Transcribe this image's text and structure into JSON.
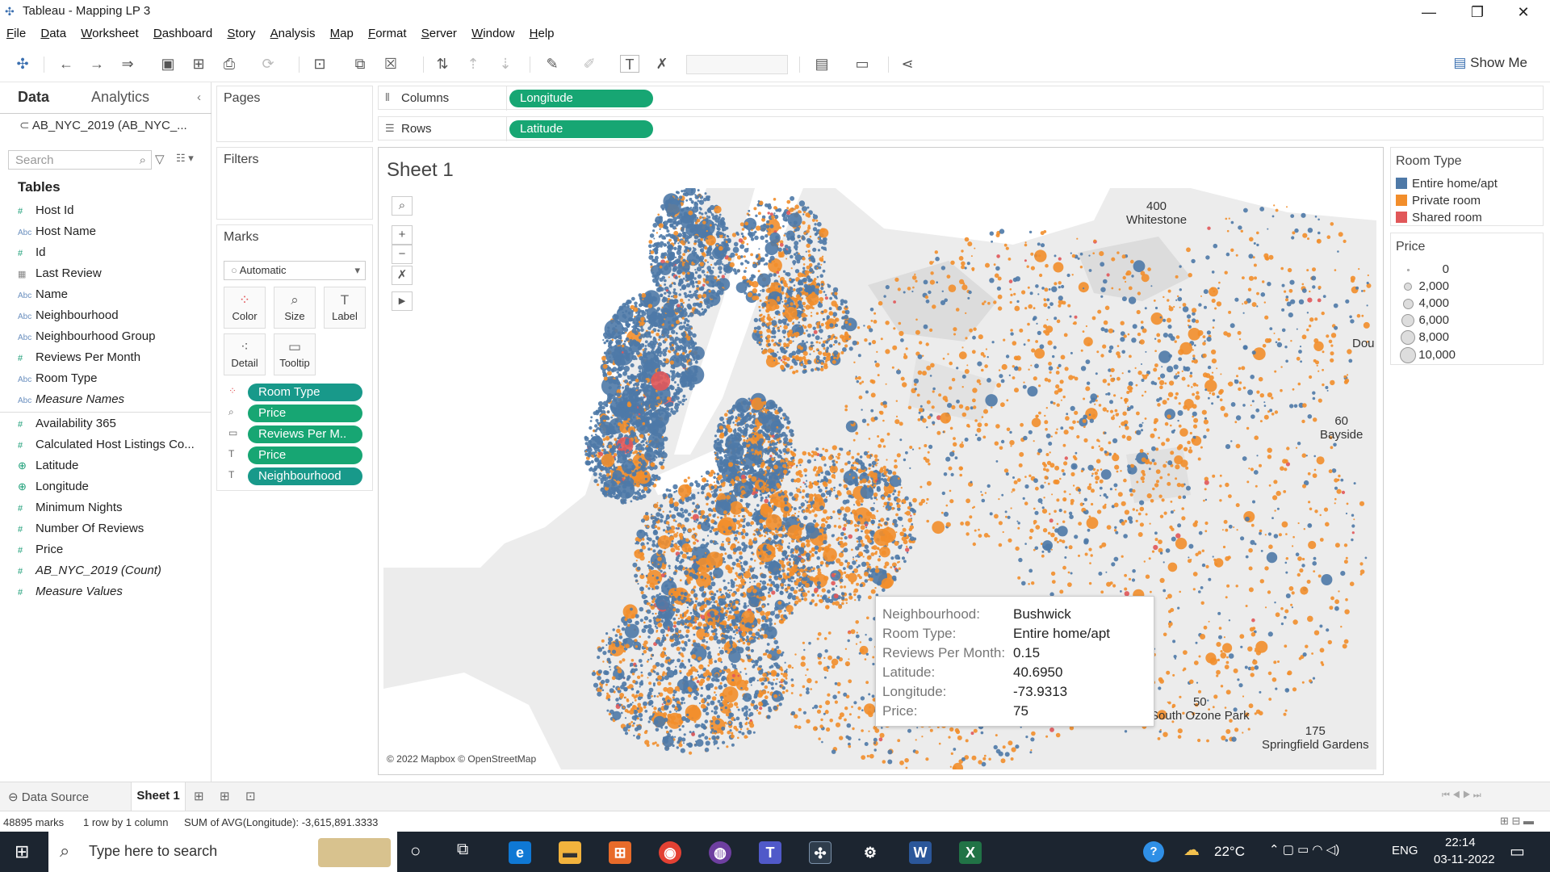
{
  "window": {
    "title": "Tableau - Mapping LP 3",
    "minimize": "—",
    "restore": "❐",
    "close": "✕"
  },
  "menu": [
    "File",
    "Data",
    "Worksheet",
    "Dashboard",
    "Story",
    "Analysis",
    "Map",
    "Format",
    "Server",
    "Window",
    "Help"
  ],
  "toolbar": {
    "show_me": "Show Me"
  },
  "data_pane": {
    "tabs": [
      "Data",
      "Analytics"
    ],
    "datasource": "AB_NYC_2019 (AB_NYC_...",
    "search_placeholder": "Search",
    "tables_heading": "Tables",
    "fields": [
      {
        "icon": "#",
        "name": "Host Id"
      },
      {
        "icon": "Abc",
        "name": "Host Name"
      },
      {
        "icon": "#",
        "name": "Id"
      },
      {
        "icon": "▦",
        "name": "Last Review"
      },
      {
        "icon": "Abc",
        "name": "Name"
      },
      {
        "icon": "Abc",
        "name": "Neighbourhood"
      },
      {
        "icon": "Abc",
        "name": "Neighbourhood Group"
      },
      {
        "icon": "#",
        "name": "Reviews Per Month"
      },
      {
        "icon": "Abc",
        "name": "Room Type"
      },
      {
        "icon": "Abc",
        "name": "Measure Names"
      },
      {
        "icon": "#",
        "name": "Availability 365"
      },
      {
        "icon": "#",
        "name": "Calculated Host Listings Co..."
      },
      {
        "icon": "⊕",
        "name": "Latitude"
      },
      {
        "icon": "⊕",
        "name": "Longitude"
      },
      {
        "icon": "#",
        "name": "Minimum Nights"
      },
      {
        "icon": "#",
        "name": "Number Of Reviews"
      },
      {
        "icon": "#",
        "name": "Price"
      },
      {
        "icon": "#",
        "name": "AB_NYC_2019 (Count)"
      },
      {
        "icon": "#",
        "name": "Measure Values"
      }
    ]
  },
  "shelves": {
    "pages": "Pages",
    "filters": "Filters",
    "columns_label": "Columns",
    "columns_pill": "Longitude",
    "rows_label": "Rows",
    "rows_pill": "Latitude"
  },
  "marks": {
    "title": "Marks",
    "mark_type": "Automatic",
    "buttons": [
      "Color",
      "Size",
      "Label",
      "Detail",
      "Tooltip"
    ],
    "pills": [
      "Room Type",
      "Price",
      "Reviews Per M..",
      "Price",
      "Neighbourhood"
    ]
  },
  "view": {
    "sheet_title": "Sheet 1",
    "attribution": "© 2022 Mapbox © OpenStreetMap",
    "map_labels": [
      {
        "name": "400",
        "sub": "Whitestone"
      },
      {
        "name": "Dou",
        "sub": ""
      },
      {
        "name": "60",
        "sub": "Bayside"
      },
      {
        "name": "50",
        "sub": "South Ozone Park"
      },
      {
        "name": "175",
        "sub": "Springfield Gardens"
      }
    ]
  },
  "tooltip": [
    {
      "k": "Neighbourhood:",
      "v": "Bushwick"
    },
    {
      "k": "Room Type:",
      "v": "Entire home/apt"
    },
    {
      "k": "Reviews Per Month:",
      "v": "0.15"
    },
    {
      "k": "Latitude:",
      "v": "40.6950"
    },
    {
      "k": "Longitude:",
      "v": "-73.9313"
    },
    {
      "k": "Price:",
      "v": "75"
    }
  ],
  "legend_room": {
    "title": "Room Type",
    "items": [
      {
        "label": "Entire home/apt",
        "color": "#4e79a7"
      },
      {
        "label": "Private room",
        "color": "#f28e2b"
      },
      {
        "label": "Shared room",
        "color": "#e15759"
      }
    ]
  },
  "legend_price": {
    "title": "Price",
    "items": [
      "0",
      "2,000",
      "4,000",
      "6,000",
      "8,000",
      "10,000"
    ]
  },
  "sheet_tabs": {
    "data_source": "Data Source",
    "sheet": "Sheet 1"
  },
  "status": {
    "marks": "48895 marks",
    "rows_cols": "1 row by 1 column",
    "sum": "SUM of AVG(Longitude): -3,615,891.3333"
  },
  "taskbar": {
    "search_placeholder": "Type here to search",
    "temperature": "22°C",
    "language": "ENG",
    "time": "22:14",
    "date": "03-11-2022"
  }
}
